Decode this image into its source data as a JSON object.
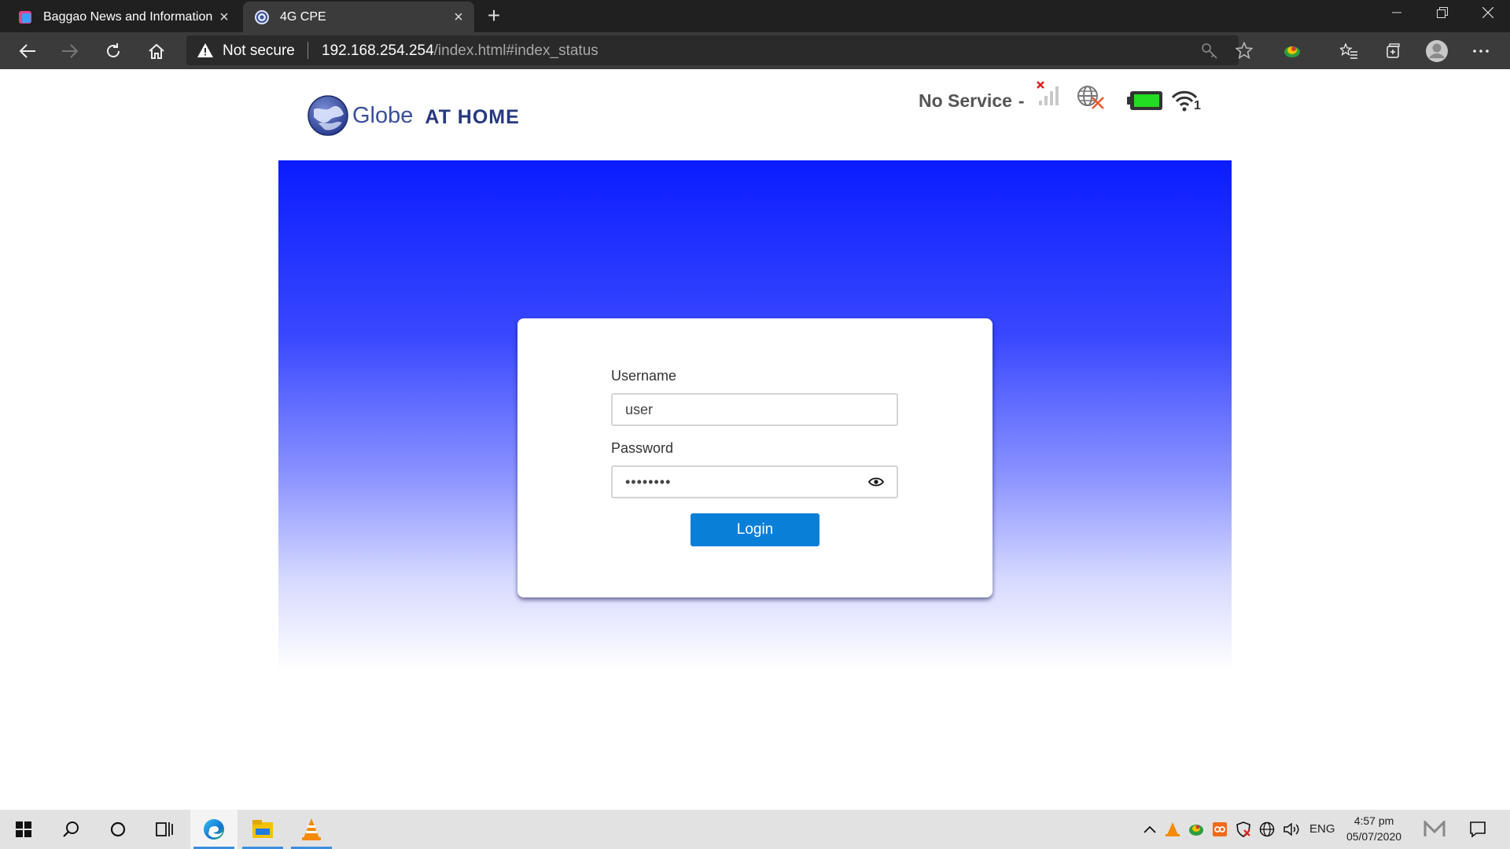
{
  "browser": {
    "tabs": [
      {
        "title": "Baggao News and Information P",
        "active": false
      },
      {
        "title": "4G CPE",
        "active": true
      }
    ],
    "address": {
      "security_label": "Not secure",
      "url_host": "192.168.254.254",
      "url_path": "/index.html#index_status"
    }
  },
  "header": {
    "logo_brand": "Globe",
    "logo_suffix": "AT HOME",
    "service_status": "No Service",
    "separator": "-",
    "wifi_clients": "1"
  },
  "login": {
    "username_label": "Username",
    "username_value": "user",
    "password_label": "Password",
    "password_masked": "••••••••",
    "login_label": "Login"
  },
  "taskbar": {
    "language": "ENG",
    "time": "4:57 pm",
    "date": "05/07/2020"
  },
  "colors": {
    "banner_top": "#0a1cff",
    "login_button": "#0a7fd8",
    "battery_fill": "#22dd22"
  }
}
